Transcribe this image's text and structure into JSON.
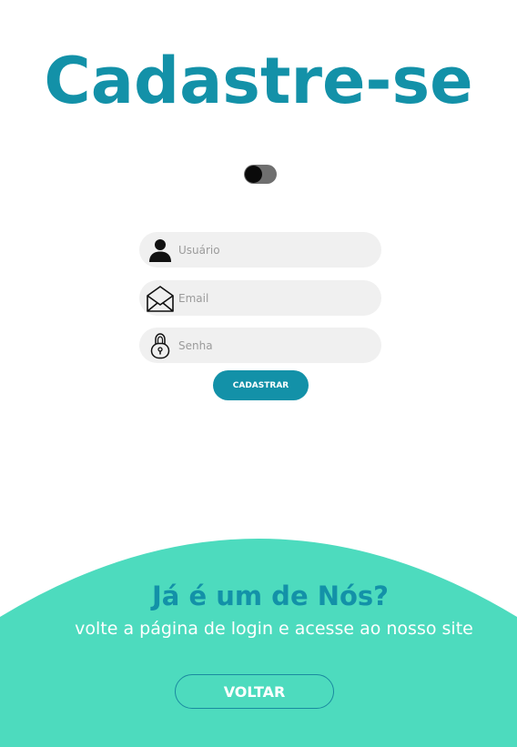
{
  "signup": {
    "title": "Cadastre-se",
    "fields": {
      "username": {
        "placeholder": "Usuário",
        "value": "",
        "icon": "user-icon"
      },
      "email": {
        "placeholder": "Email",
        "value": "",
        "icon": "envelope-icon"
      },
      "password": {
        "placeholder": "Senha",
        "value": "",
        "icon": "lock-icon"
      }
    },
    "submit_label": "CADASTRAR"
  },
  "theme_toggle": {
    "state": "off"
  },
  "login_panel": {
    "heading": "Já é um de Nós?",
    "text": "volte a página de login e acesse ao nosso site",
    "back_label": "VOLTAR"
  },
  "colors": {
    "primary": "#1391a8",
    "panel": "#4ddbbe",
    "field_bg": "#f0f0f0"
  }
}
